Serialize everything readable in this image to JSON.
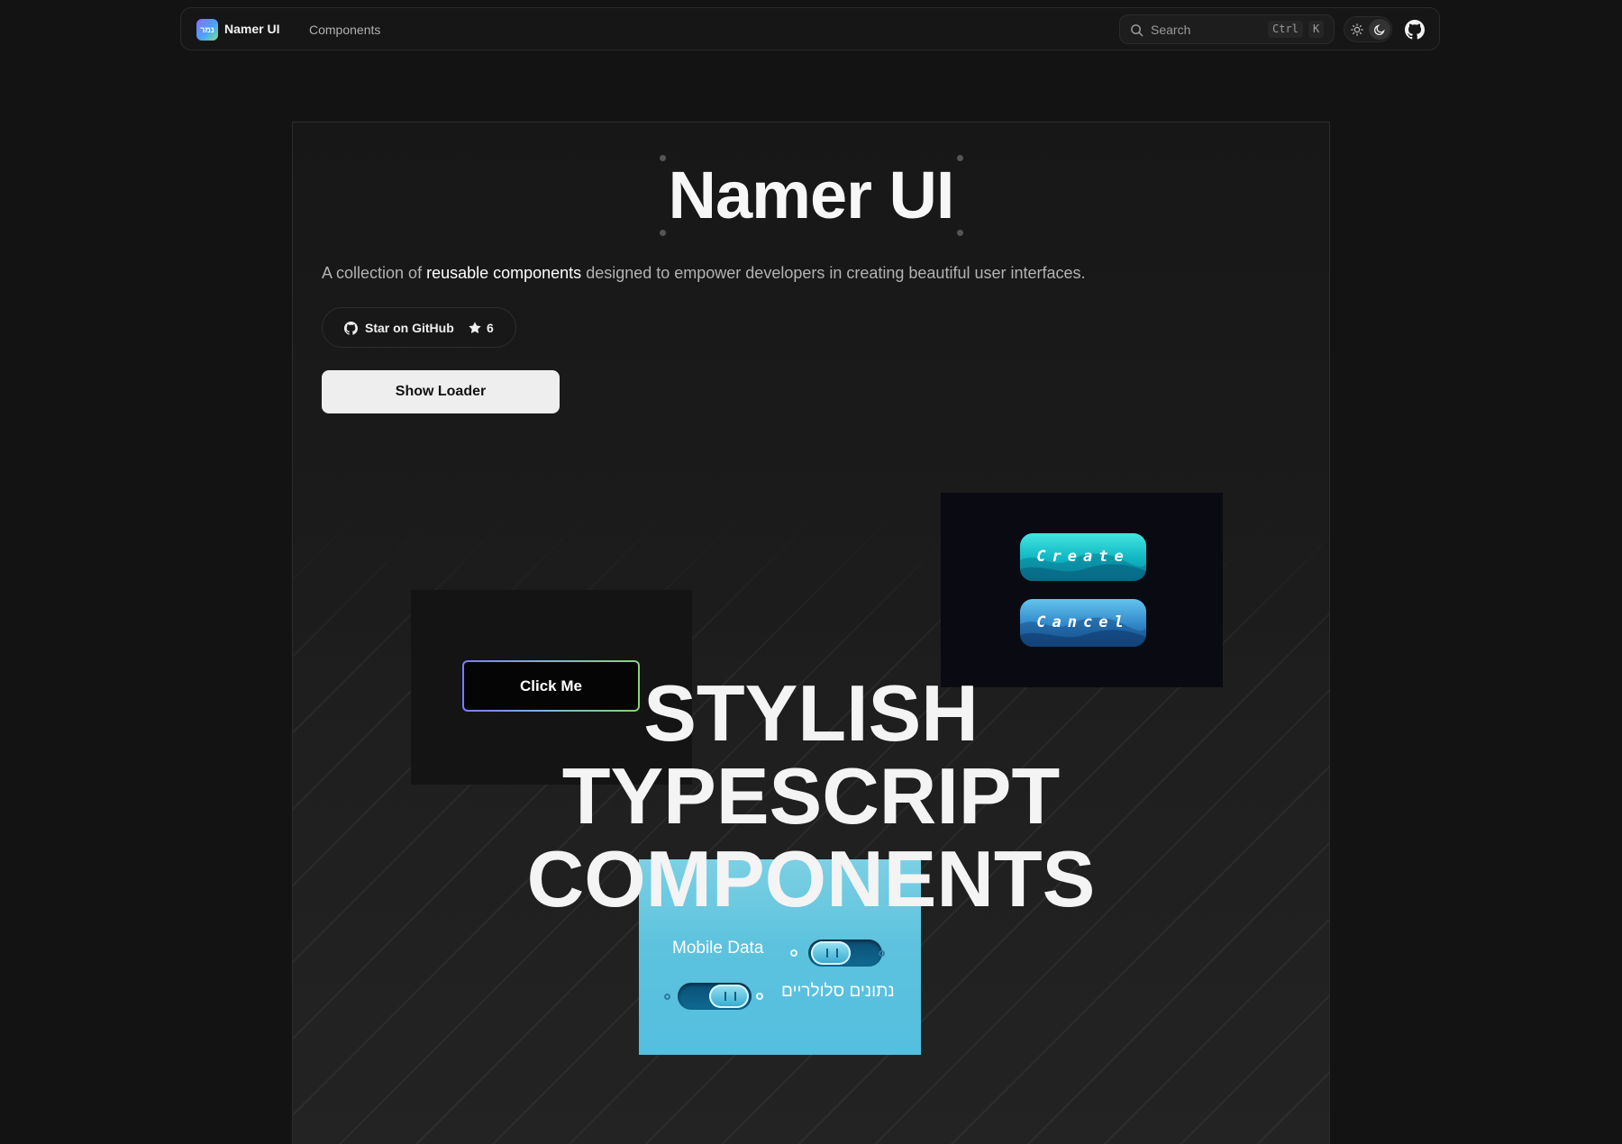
{
  "nav": {
    "logo_text": "נמר",
    "brand": "Namer UI",
    "link_components": "Components",
    "search_placeholder": "Search",
    "kbd_ctrl": "Ctrl",
    "kbd_k": "K",
    "icons": [
      "search-icon",
      "sun-icon",
      "moon-icon",
      "github-icon"
    ]
  },
  "hero": {
    "title": "Namer UI",
    "subtitle_pre": "A collection of ",
    "subtitle_highlight": "reusable components",
    "subtitle_post": " designed to empower developers in creating beautiful user interfaces.",
    "star_label": "Star on GitHub",
    "star_count": "6",
    "loader_button": "Show Loader"
  },
  "showcase": {
    "click_button": "Click Me",
    "create_button": "Create",
    "cancel_button": "Cancel",
    "toggle_en_label": "Mobile Data",
    "toggle_he_label": "נתונים סלולריים",
    "headline_1": "STYLISH",
    "headline_2": "TYPESCRIPT",
    "headline_3": "COMPONENTS"
  },
  "colors": {
    "background": "#131313",
    "accent_cyan": "#12b9c4",
    "accent_blue": "#2f86c7"
  }
}
